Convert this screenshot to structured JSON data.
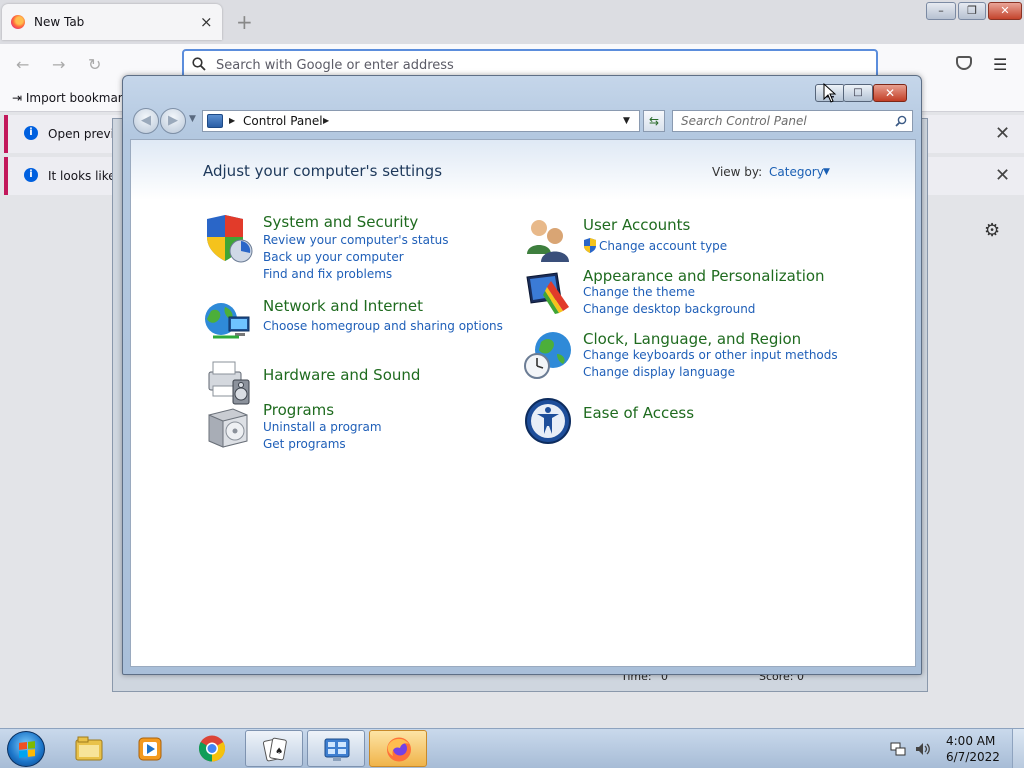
{
  "firefox": {
    "tab_title": "New Tab",
    "tab_close": "×",
    "new_tab": "+",
    "url_placeholder": "Search with Google or enter address",
    "import_bookmarks": "Import bookmark",
    "notice1": "Open previo",
    "notice2": "It looks like y",
    "notice_close": "✕"
  },
  "behind_window": {
    "time_label": "Time:",
    "time_value": "0",
    "score_label": "Score:",
    "score_value": "0"
  },
  "control_panel": {
    "breadcrumb": "Control Panel",
    "search_placeholder": "Search Control Panel",
    "heading": "Adjust your computer's settings",
    "view_by_label": "View by:",
    "view_by_value": "Category",
    "left_categories": [
      {
        "title": "System and Security",
        "links": [
          "Review your computer's status",
          "Back up your computer",
          "Find and fix problems"
        ]
      },
      {
        "title": "Network and Internet",
        "links": [
          "Choose homegroup and sharing options"
        ]
      },
      {
        "title": "Hardware and Sound",
        "links": []
      },
      {
        "title": "Programs",
        "links": [
          "Uninstall a program",
          "Get programs"
        ]
      }
    ],
    "right_categories": [
      {
        "title": "User Accounts",
        "links": [
          "Change account type"
        ]
      },
      {
        "title": "Appearance and Personalization",
        "links": [
          "Change the theme",
          "Change desktop background"
        ]
      },
      {
        "title": "Clock, Language, and Region",
        "links": [
          "Change keyboards or other input methods",
          "Change display language"
        ]
      },
      {
        "title": "Ease of Access",
        "links": []
      }
    ]
  },
  "taskbar": {
    "clock_time": "4:00 AM",
    "clock_date": "6/7/2022"
  }
}
